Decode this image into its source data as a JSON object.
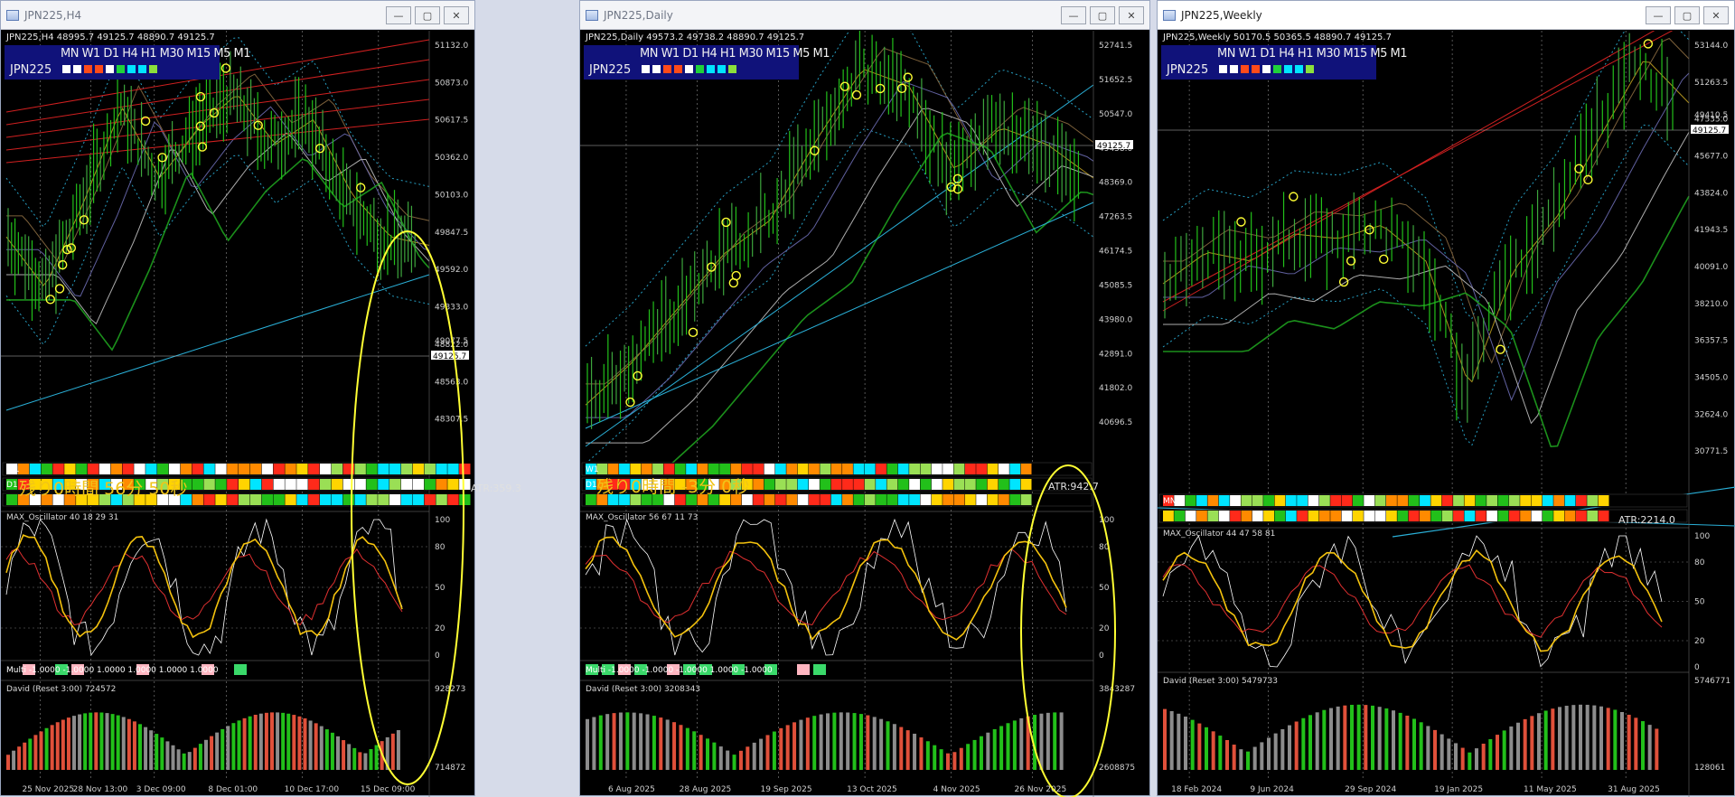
{
  "windows": [
    {
      "id": "h4",
      "title": "JPN225,H4",
      "header": "JPN225,H4  48995.7 49125.7 48890.7 49125.7",
      "timer": "残り0時間 56分 50秒",
      "atr": "ATR:359.3",
      "current_price": "49125.7",
      "extra_price": "49077.5",
      "price_labels": [
        "51132.0",
        "50873.0",
        "50617.5",
        "50362.0",
        "50103.0",
        "49847.5",
        "49592.0",
        "49333.0",
        "48822.0",
        "48563.0",
        "48307.5"
      ],
      "row_labels": [
        "W1",
        "D1",
        ""
      ],
      "osc_label": "MAX_Oscillator 40 18 29 31",
      "osc_levels": [
        "100",
        "80",
        "50",
        "20",
        "0"
      ],
      "multi_label": "Multi -1.0000 -1.0000 1.0000 1.0000 1.0000 1.0000",
      "david_label": "David (Reset 3:00) 724572",
      "david_top": "928273",
      "david_bottom": "714872",
      "dates": [
        "25 Nov 2025",
        "28 Nov 13:00",
        "3 Dec 09:00",
        "8 Dec 01:00",
        "10 Dec 17:00",
        "15 Dec 09:00"
      ]
    },
    {
      "id": "d1",
      "title": "JPN225,Daily",
      "header": "JPN225,Daily  49573.2 49738.2 48890.7 49125.7",
      "timer": "残り0時間 -3分 0秒",
      "atr": "ATR:942.7",
      "current_price": "49125.7",
      "extra_price": "",
      "price_labels": [
        "52741.5",
        "51652.5",
        "50547.0",
        "49458.0",
        "48369.0",
        "47263.5",
        "46174.5",
        "45085.5",
        "43980.0",
        "42891.0",
        "41802.0",
        "40696.5"
      ],
      "row_labels": [
        "W1",
        "D1",
        ""
      ],
      "osc_label": "MAX_Oscillator 56 67 11 73",
      "osc_levels": [
        "100",
        "80",
        "50",
        "20",
        "0"
      ],
      "multi_label": "Multi -1.0000 -1.0000 -1.0000 1.0000 -1.0000",
      "david_label": "David (Reset 3:00) 3208343",
      "david_top": "3843287",
      "david_bottom": "2608875",
      "dates": [
        "6 Aug 2025",
        "28 Aug 2025",
        "19 Sep 2025",
        "13 Oct 2025",
        "4 Nov 2025",
        "26 Nov 2025"
      ]
    },
    {
      "id": "w1",
      "title": "JPN225,Weekly",
      "header": "JPN225,Weekly  50170.5 50365.5 48890.7 49125.7",
      "timer": "",
      "atr": "ATR:2214.0",
      "current_price": "49125.7",
      "extra_price": "49410.5",
      "price_labels": [
        "53144.0",
        "51263.5",
        "47535.0",
        "45677.0",
        "43824.0",
        "41943.5",
        "40091.0",
        "38210.0",
        "36357.5",
        "34505.0",
        "32624.0",
        "30771.5"
      ],
      "row_labels": [
        "MN",
        ""
      ],
      "osc_label": "MAX_Oscillator 44 47 58 81",
      "osc_levels": [
        "100",
        "80",
        "50",
        "20",
        "0"
      ],
      "multi_label": "",
      "david_label": "David (Reset 3:00) 5479733",
      "david_top": "5746771",
      "david_bottom": "128061",
      "dates": [
        "18 Feb 2024",
        "9 Jun 2024",
        "29 Sep 2024",
        "19 Jan 2025",
        "11 May 2025",
        "31 Aug 2025"
      ]
    }
  ],
  "timeframes_label": "MN W1 D1 H4 H1 M30 M15 M5 M1",
  "symbol": "JPN225",
  "colors": {
    "bull": "#22c01a",
    "bear": "#e0503a",
    "neutral": "#8c8c8c",
    "highlight": "#ffff33",
    "trend": "#2ab0d8",
    "resist": "#d02020",
    "panel": "#10127a"
  }
}
